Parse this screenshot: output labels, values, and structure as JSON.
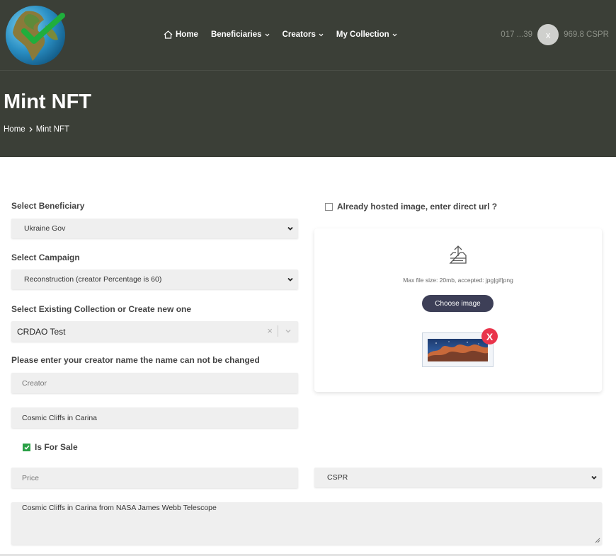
{
  "nav": {
    "items": [
      {
        "label": "Home"
      },
      {
        "label": "Beneficiaries"
      },
      {
        "label": "Creators"
      },
      {
        "label": "My Collection"
      }
    ]
  },
  "wallet": {
    "address": "017 ...39",
    "avatar_letter": "x",
    "balance": "969.8 CSPR"
  },
  "page": {
    "title": "Mint NFT",
    "breadcrumb": [
      "Home",
      "Mint NFT"
    ]
  },
  "form": {
    "beneficiary": {
      "label": "Select Beneficiary",
      "value": "Ukraine Gov"
    },
    "campaign": {
      "label": "Select Campaign",
      "value": "Reconstruction (creator Percentage is 60)"
    },
    "collection": {
      "label": "Select Existing Collection or Create new one",
      "value": "CRDAO Test"
    },
    "creator": {
      "label": "Please enter your creator name the name can not be changed",
      "placeholder": "Creator"
    },
    "nft_name": {
      "value": "Cosmic Cliffs in Carina"
    },
    "for_sale": {
      "label": "Is For Sale",
      "checked": true
    },
    "price": {
      "placeholder": "Price"
    },
    "currency": {
      "value": "CSPR"
    },
    "description": {
      "value": "Cosmic Cliffs in Carina from NASA James Webb Telescope"
    }
  },
  "upload": {
    "hosted_label": "Already hosted image, enter direct url ?",
    "hosted_checked": false,
    "note": "Max file size: 20mb, accepted: jpg|gif|png",
    "button_label": "Choose image",
    "remove_label": "X"
  },
  "colors": {
    "header_bg": "#3b3f37",
    "button_bg": "#3d3f57",
    "remove_bg": "#e9344b",
    "check_green": "#2aa046"
  }
}
